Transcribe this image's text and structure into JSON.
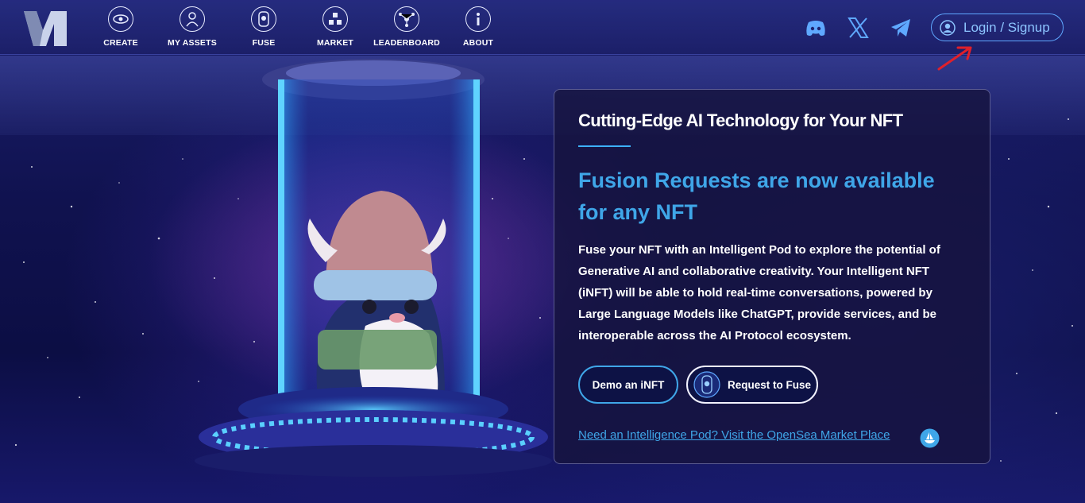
{
  "nav": {
    "items": [
      {
        "label": "CREATE",
        "icon": "eye-icon"
      },
      {
        "label": "MY ASSETS",
        "icon": "user-icon"
      },
      {
        "label": "FUSE",
        "icon": "fuse-icon"
      },
      {
        "label": "MARKET",
        "icon": "market-icon"
      },
      {
        "label": "LEADERBOARD",
        "icon": "network-icon"
      },
      {
        "label": "ABOUT",
        "icon": "info-icon"
      }
    ],
    "social": [
      "discord-icon",
      "x-icon",
      "telegram-icon"
    ],
    "login_label": "Login / Signup"
  },
  "card": {
    "heading": "Cutting-Edge AI Technology for Your NFT",
    "title": "Fusion Requests are now available for any NFT",
    "body": "Fuse your NFT with an Intelligent Pod to explore the potential of Generative AI and collaborative creativity. Your Intelligent NFT (iNFT) will be able to hold real-time conversations, powered by Large Language Models like ChatGPT, provide services, and be interoperable across the AI Protocol ecosystem.",
    "demo_button": "Demo an iNFT",
    "fuse_button": "Request to Fuse",
    "opensea_link": "Need an Intelligence Pod? Visit the OpenSea Market Place"
  },
  "colors": {
    "accent": "#3fa6e8",
    "login_border": "#5fa8ff",
    "annotation_arrow": "#e0202a"
  }
}
